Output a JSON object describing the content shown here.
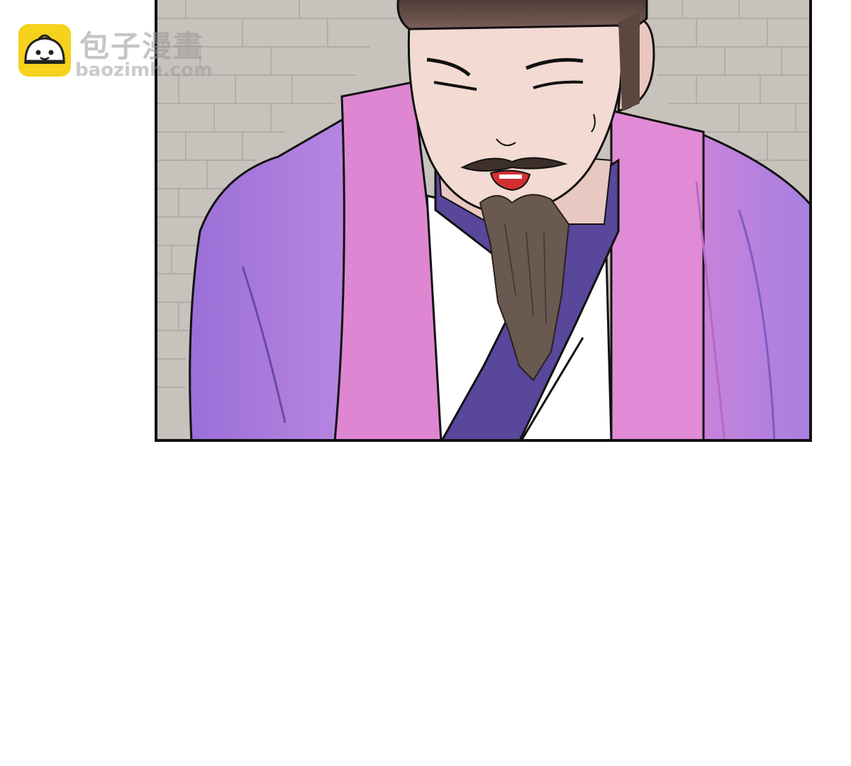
{
  "watermark": {
    "title": "包子漫畫",
    "url": "baozimh.com"
  },
  "panel": {
    "colors": {
      "border": "#111111",
      "pavement": "#c9c3bd",
      "robe_purple": "#a87ee0",
      "robe_pink": "#e07fd0",
      "collar_blue": "#5a4a9a",
      "inner_white": "#ffffff",
      "skin": "#f2d8d0",
      "hat": "#5e4842",
      "beard": "#6d5c52"
    }
  }
}
